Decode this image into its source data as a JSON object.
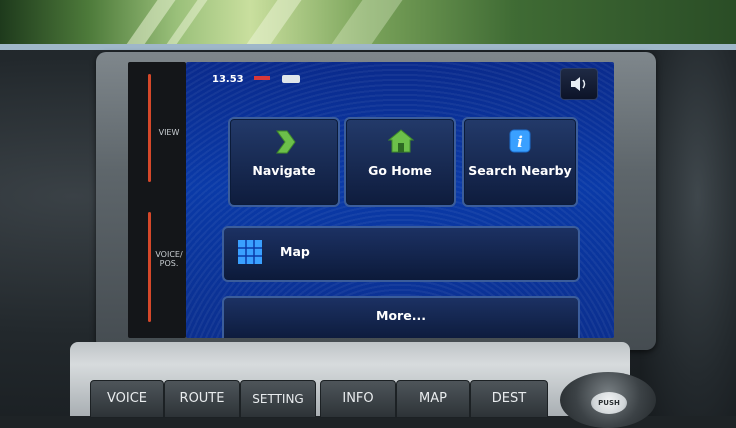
{
  "status": {
    "time": "13.53"
  },
  "sidebar": {
    "view_label": "VIEW",
    "voice_pos_label_line1": "VOICE/",
    "voice_pos_label_line2": "POS."
  },
  "menu": {
    "tiles": [
      {
        "label": "Navigate",
        "icon": "chevron-right-icon"
      },
      {
        "label": "Go Home",
        "icon": "house-icon"
      },
      {
        "label": "Search Nearby",
        "icon": "info-icon"
      }
    ],
    "map_label": "Map",
    "more_label": "More..."
  },
  "console_buttons": [
    "VOICE",
    "ROUTE",
    "SETTING",
    "INFO",
    "MAP",
    "DEST"
  ],
  "knob_label": "PUSH",
  "colors": {
    "screen_blue": "#0a3aa8",
    "tile_border": "#3b5d9b",
    "accent_red": "#d5482a",
    "icon_green": "#6cc04a",
    "icon_blue": "#3aa0ff"
  }
}
